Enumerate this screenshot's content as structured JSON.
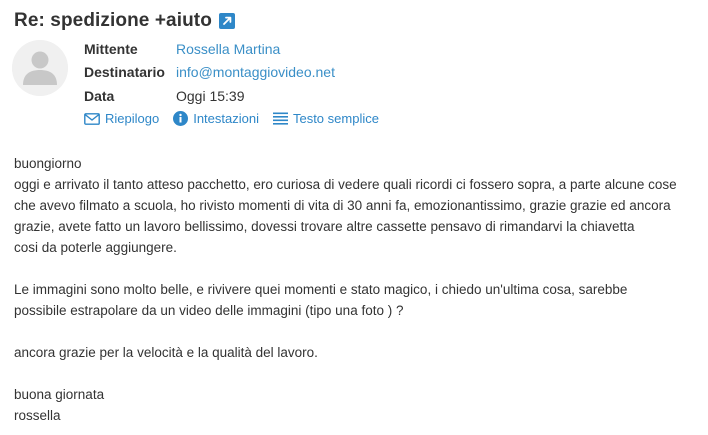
{
  "message": {
    "subject": "Re: spedizione +aiuto",
    "headers": {
      "from_label": "Mittente",
      "from_value": "Rossella Martina",
      "to_label": "Destinatario",
      "to_value": "info@montaggiovideo.net",
      "date_label": "Data",
      "date_value": "Oggi 15:39"
    },
    "toolbar": {
      "summary_label": "Riepilogo",
      "headers_label": "Intestazioni",
      "plaintext_label": "Testo semplice"
    },
    "body_lines": [
      "buongiorno",
      "oggi e arrivato il tanto atteso pacchetto, ero curiosa di vedere quali ricordi ci fossero sopra, a parte alcune cose",
      "che avevo filmato a scuola, ho rivisto momenti di vita di 30 anni fa, emozionantissimo, grazie grazie ed ancora",
      "grazie, avete fatto un lavoro bellissimo, dovessi trovare altre cassette pensavo di rimandarvi la chiavetta",
      "cosi da poterle aggiungere.",
      "",
      "Le immagini sono molto belle, e rivivere quei momenti e stato magico, i chiedo un'ultima cosa, sarebbe",
      "possibile estrapolare da un video delle immagini (tipo una foto ) ?",
      "",
      "ancora grazie per la velocità e la qualità del lavoro.",
      "",
      "buona giornata",
      "rossella"
    ]
  },
  "icons": {
    "popout": "external-window-icon",
    "avatar": "user-avatar-icon",
    "summary": "envelope-icon",
    "headers": "info-icon",
    "plaintext": "lines-icon"
  },
  "colors": {
    "link": "#3a8fc7",
    "accent": "#2e87c8",
    "text": "#333333"
  }
}
